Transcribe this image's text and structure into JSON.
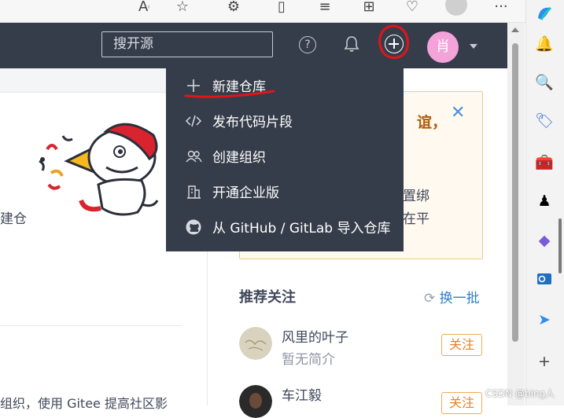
{
  "header": {
    "search_placeholder": "搜开源",
    "help_glyph": "?",
    "user_initial": "肖"
  },
  "dropdown": {
    "items": [
      {
        "label": "新建仓库",
        "icon": "plus-icon"
      },
      {
        "label": "发布代码片段",
        "icon": "code-icon"
      },
      {
        "label": "创建组织",
        "icon": "users-icon"
      },
      {
        "label": "开通企业版",
        "icon": "building-icon"
      },
      {
        "label": "从 GitHub / GitLab 导入仓库",
        "icon": "github-icon"
      }
    ]
  },
  "left": {
    "text1": "建仓",
    "text2": "组织，使用 Gitee 提高社区影"
  },
  "notice": {
    "title_fragment": "谊，",
    "line1": "置绑",
    "line2": "在平"
  },
  "recommend": {
    "title": "推荐关注",
    "refresh_label": "换一批",
    "people": [
      {
        "name": "风里的叶子",
        "bio": "暂无简介",
        "follow_label": "关注"
      },
      {
        "name": "车江毅",
        "bio": "",
        "follow_label": "关注"
      }
    ]
  },
  "watermark": "CSDN @bing人",
  "colors": {
    "header_bg": "#363d4a",
    "accent_blue": "#2c7fd0",
    "follow_orange": "#e8812a",
    "annotation_red": "#e2141a"
  }
}
